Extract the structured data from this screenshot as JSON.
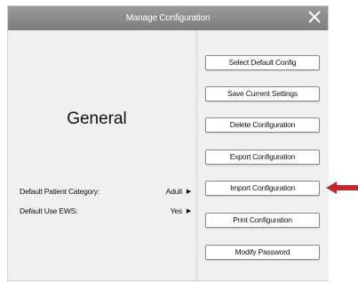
{
  "dialog": {
    "title": "Manage Configuration",
    "close_icon": "close-icon"
  },
  "left": {
    "heading": "General",
    "settings": [
      {
        "label": "Default Patient Category:",
        "value": "Adult"
      },
      {
        "label": "Default Use EWS:",
        "value": "Yes"
      }
    ]
  },
  "buttons": {
    "select_default": "Select Default Config",
    "save_current": "Save Current Settings",
    "delete": "Delete Configuration",
    "export": "Export Configuration",
    "import": "Import Configuration",
    "print": "Print Configuration",
    "modify_password": "Modify Password"
  },
  "annotation": {
    "arrow_color": "#c0272d",
    "caret_icon": "caret-right-icon"
  }
}
